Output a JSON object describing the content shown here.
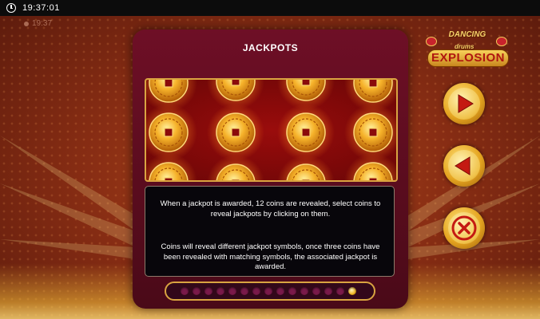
{
  "status_bar": {
    "time": "19:37:01",
    "ghost_time": "19:37"
  },
  "logo": {
    "line1": "DANCING",
    "line2": "drums",
    "line3": "EXPLOSION"
  },
  "panel": {
    "title": "JACKPOTS",
    "paragraph1": "When a jackpot is awarded, 12 coins are revealed, select coins to reveal jackpots by clicking on them.",
    "paragraph2": "Coins will reveal different jackpot symbols, once three coins have been revealed with matching symbols, the associated jackpot is awarded."
  },
  "pager": {
    "total_pages": 15,
    "current_page": 15
  },
  "buttons": {
    "next": {
      "icon": "play-right-icon"
    },
    "prev": {
      "icon": "play-left-icon"
    },
    "close": {
      "icon": "close-x-icon"
    }
  },
  "colors": {
    "gold": "#d9a441",
    "panel": "#6e0f26",
    "accent_red": "#c41a12"
  }
}
